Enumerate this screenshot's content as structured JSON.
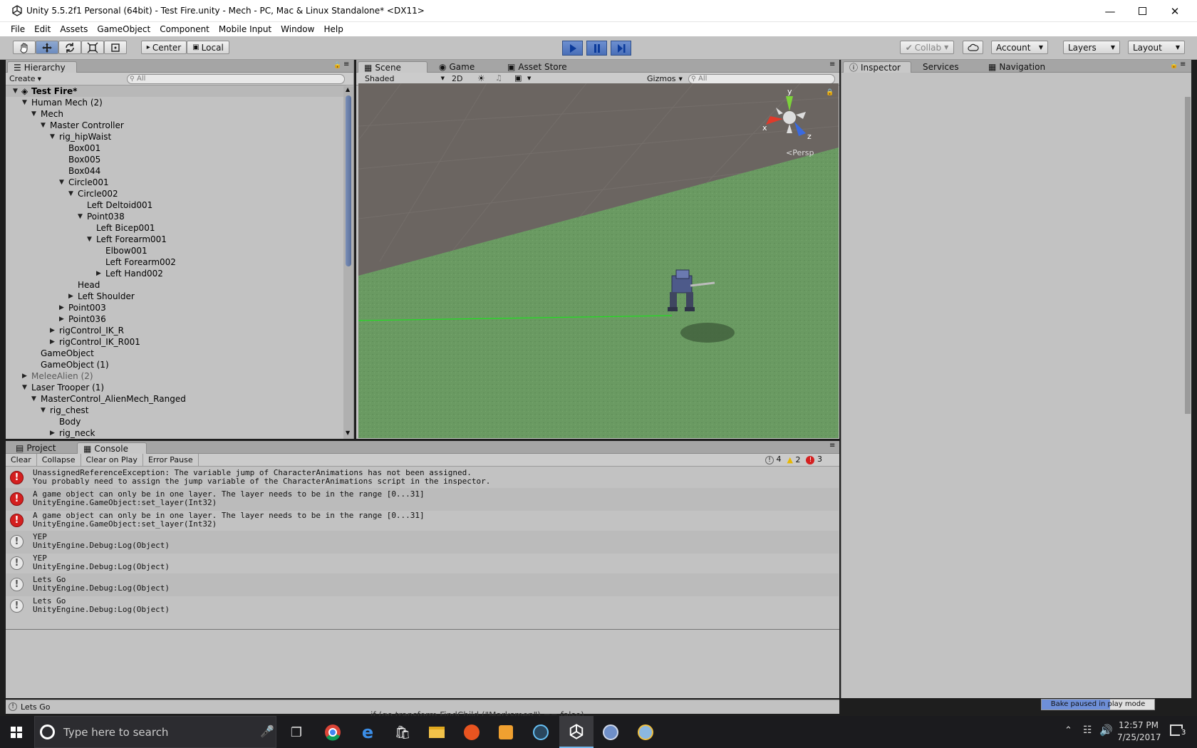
{
  "window": {
    "title": "Unity 5.5.2f1 Personal (64bit) - Test Fire.unity - Mech - PC, Mac & Linux Standalone* <DX11>",
    "minimize_icon": "minimize-icon",
    "maximize_icon": "maximize-icon",
    "close_icon": "close-icon"
  },
  "menu": [
    "File",
    "Edit",
    "Assets",
    "GameObject",
    "Component",
    "Mobile Input",
    "Window",
    "Help"
  ],
  "toolbar": {
    "tools": [
      "hand-icon",
      "move-icon",
      "rotate-icon",
      "scale-icon",
      "rect-icon"
    ],
    "pivot_label": "Center",
    "space_label": "Local",
    "play_icon": "play-icon",
    "pause_icon": "pause-icon",
    "step_icon": "step-icon",
    "collab_label": "Collab",
    "account_label": "Account",
    "layers_label": "Layers",
    "layout_label": "Layout",
    "accent": "#4a6fb8"
  },
  "hierarchy": {
    "tab_label": "Hierarchy",
    "create_label": "Create",
    "search_placeholder": "All",
    "rows": [
      {
        "label": "Test Fire*",
        "indent": 0,
        "arrow": "open",
        "root": true
      },
      {
        "label": "Human Mech (2)",
        "indent": 1,
        "arrow": "open"
      },
      {
        "label": "Mech",
        "indent": 2,
        "arrow": "open"
      },
      {
        "label": "Master Controller",
        "indent": 3,
        "arrow": "open"
      },
      {
        "label": "rig_hipWaist",
        "indent": 4,
        "arrow": "open"
      },
      {
        "label": "Box001",
        "indent": 5,
        "arrow": ""
      },
      {
        "label": "Box005",
        "indent": 5,
        "arrow": ""
      },
      {
        "label": "Box044",
        "indent": 5,
        "arrow": ""
      },
      {
        "label": "Circle001",
        "indent": 5,
        "arrow": "open"
      },
      {
        "label": "Circle002",
        "indent": 6,
        "arrow": "open"
      },
      {
        "label": "Left Deltoid001",
        "indent": 7,
        "arrow": ""
      },
      {
        "label": "Point038",
        "indent": 7,
        "arrow": "open"
      },
      {
        "label": "Left Bicep001",
        "indent": 8,
        "arrow": ""
      },
      {
        "label": "Left Forearm001",
        "indent": 8,
        "arrow": "open"
      },
      {
        "label": "Elbow001",
        "indent": 9,
        "arrow": ""
      },
      {
        "label": "Left Forearm002",
        "indent": 9,
        "arrow": ""
      },
      {
        "label": "Left Hand002",
        "indent": 9,
        "arrow": "closed"
      },
      {
        "label": "Head",
        "indent": 6,
        "arrow": ""
      },
      {
        "label": "Left Shoulder",
        "indent": 6,
        "arrow": "closed"
      },
      {
        "label": "Point003",
        "indent": 5,
        "arrow": "closed"
      },
      {
        "label": "Point036",
        "indent": 5,
        "arrow": "closed"
      },
      {
        "label": "rigControl_IK_R",
        "indent": 4,
        "arrow": "closed"
      },
      {
        "label": "rigControl_IK_R001",
        "indent": 4,
        "arrow": "closed"
      },
      {
        "label": "GameObject",
        "indent": 2,
        "arrow": ""
      },
      {
        "label": "GameObject (1)",
        "indent": 2,
        "arrow": ""
      },
      {
        "label": "MeleeAlien (2)",
        "indent": 1,
        "arrow": "closed",
        "dim": true
      },
      {
        "label": "Laser Trooper (1)",
        "indent": 1,
        "arrow": "open"
      },
      {
        "label": "MasterControl_AlienMech_Ranged",
        "indent": 2,
        "arrow": "open"
      },
      {
        "label": "rig_chest",
        "indent": 3,
        "arrow": "open"
      },
      {
        "label": "Body",
        "indent": 4,
        "arrow": ""
      },
      {
        "label": "rig_neck",
        "indent": 4,
        "arrow": "closed"
      }
    ]
  },
  "scene": {
    "tabs": [
      "Scene",
      "Game",
      "Asset Store"
    ],
    "shading": "Shaded",
    "mode_2d": "2D",
    "gizmos_label": "Gizmos",
    "search_placeholder": "All",
    "axis_y": "y",
    "axis_x": "x",
    "axis_z": "z",
    "projection": "Persp"
  },
  "inspector": {
    "tabs": [
      "Inspector",
      "Services",
      "Navigation"
    ]
  },
  "console": {
    "tabs": [
      "Project",
      "Console"
    ],
    "buttons": [
      "Clear",
      "Collapse",
      "Clear on Play",
      "Error Pause"
    ],
    "count_log": "4",
    "count_warn": "2",
    "count_err": "3",
    "entries": [
      {
        "type": "error",
        "line1": "UnassignedReferenceException: The variable jump of CharacterAnimations has not been assigned.",
        "line2": "You probably need to assign the jump variable of the CharacterAnimations script in the inspector."
      },
      {
        "type": "error",
        "line1": "A game object can only be in one layer. The layer needs to be in the range [0...31]",
        "line2": "UnityEngine.GameObject:set_layer(Int32)"
      },
      {
        "type": "error",
        "line1": "A game object can only be in one layer. The layer needs to be in the range [0...31]",
        "line2": "UnityEngine.GameObject:set_layer(Int32)"
      },
      {
        "type": "log",
        "line1": "YEP",
        "line2": "UnityEngine.Debug:Log(Object)"
      },
      {
        "type": "log",
        "line1": "YEP",
        "line2": "UnityEngine.Debug:Log(Object)"
      },
      {
        "type": "log",
        "line1": "Lets Go",
        "line2": "UnityEngine.Debug:Log(Object)"
      },
      {
        "type": "log",
        "line1": "Lets Go",
        "line2": "UnityEngine.Debug:Log(Object)"
      }
    ]
  },
  "statusbar": {
    "message": "Lets Go",
    "bake_text": "Bake paused in play mode",
    "behind_text": "if (go.transform.FindChild (\"Marksmen\") == false)"
  },
  "taskbar": {
    "search_placeholder": "Type here to search",
    "time": "12:57 PM",
    "date": "7/25/2017",
    "notification_count": "3",
    "apps": [
      "chrome-icon",
      "edge-icon",
      "store-icon",
      "file-explorer-icon",
      "ubuntu-icon",
      "media-icon",
      "steam-icon",
      "unity-icon",
      "app-icon",
      "paint-icon"
    ]
  }
}
